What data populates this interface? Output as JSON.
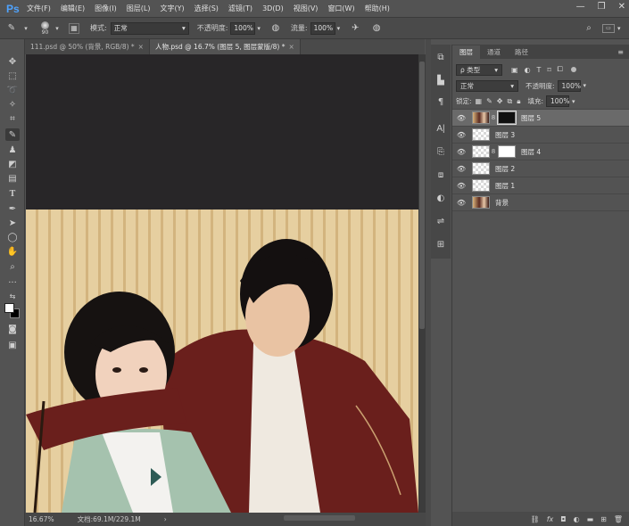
{
  "app": {
    "logo": "Ps"
  },
  "menu": [
    "文件(F)",
    "编辑(E)",
    "图像(I)",
    "图层(L)",
    "文字(Y)",
    "选择(S)",
    "滤镜(T)",
    "3D(D)",
    "视图(V)",
    "窗口(W)",
    "帮助(H)"
  ],
  "window_controls": [
    "—",
    "❐",
    "✕"
  ],
  "options": {
    "brush_size": "90",
    "mode_label": "模式:",
    "mode_value": "正常",
    "opacity_label": "不透明度:",
    "opacity_value": "100%",
    "flow_label": "流量:",
    "flow_value": "100%"
  },
  "tabs": [
    {
      "label": "111.psd @ 50% (背景, RGB/8) *",
      "close": "×"
    },
    {
      "label": "人物.psd @ 16.7% (图层 5, 图层蒙版/8) *",
      "close": "×"
    }
  ],
  "status": {
    "zoom": "16.67%",
    "doc": "文档:69.1M/229.1M",
    "arrow": "›"
  },
  "layers_panel": {
    "tabs": [
      "图层",
      "通道",
      "路径"
    ],
    "kind_label": "ρ 类型",
    "blend_mode": "正常",
    "opacity_label": "不透明度:",
    "opacity_value": "100%",
    "lock_label": "锁定:",
    "fill_label": "填充:",
    "fill_value": "100%",
    "layers": [
      {
        "name": "图层 5",
        "thumb": "photo",
        "mask": "black",
        "active": true
      },
      {
        "name": "图层 3",
        "thumb": "checker",
        "mask": "",
        "active": false
      },
      {
        "name": "图层 4",
        "thumb": "checker",
        "mask": "white",
        "active": false
      },
      {
        "name": "图层 2",
        "thumb": "checker",
        "mask": "",
        "active": false
      },
      {
        "name": "图层 1",
        "thumb": "checker",
        "mask": "",
        "active": false
      },
      {
        "name": "背景",
        "thumb": "photo",
        "mask": "",
        "active": false
      }
    ]
  },
  "colors": {
    "accent_logo": "#4fa3ff",
    "canvas_bg": "#282628",
    "panel_bg": "#535353"
  }
}
